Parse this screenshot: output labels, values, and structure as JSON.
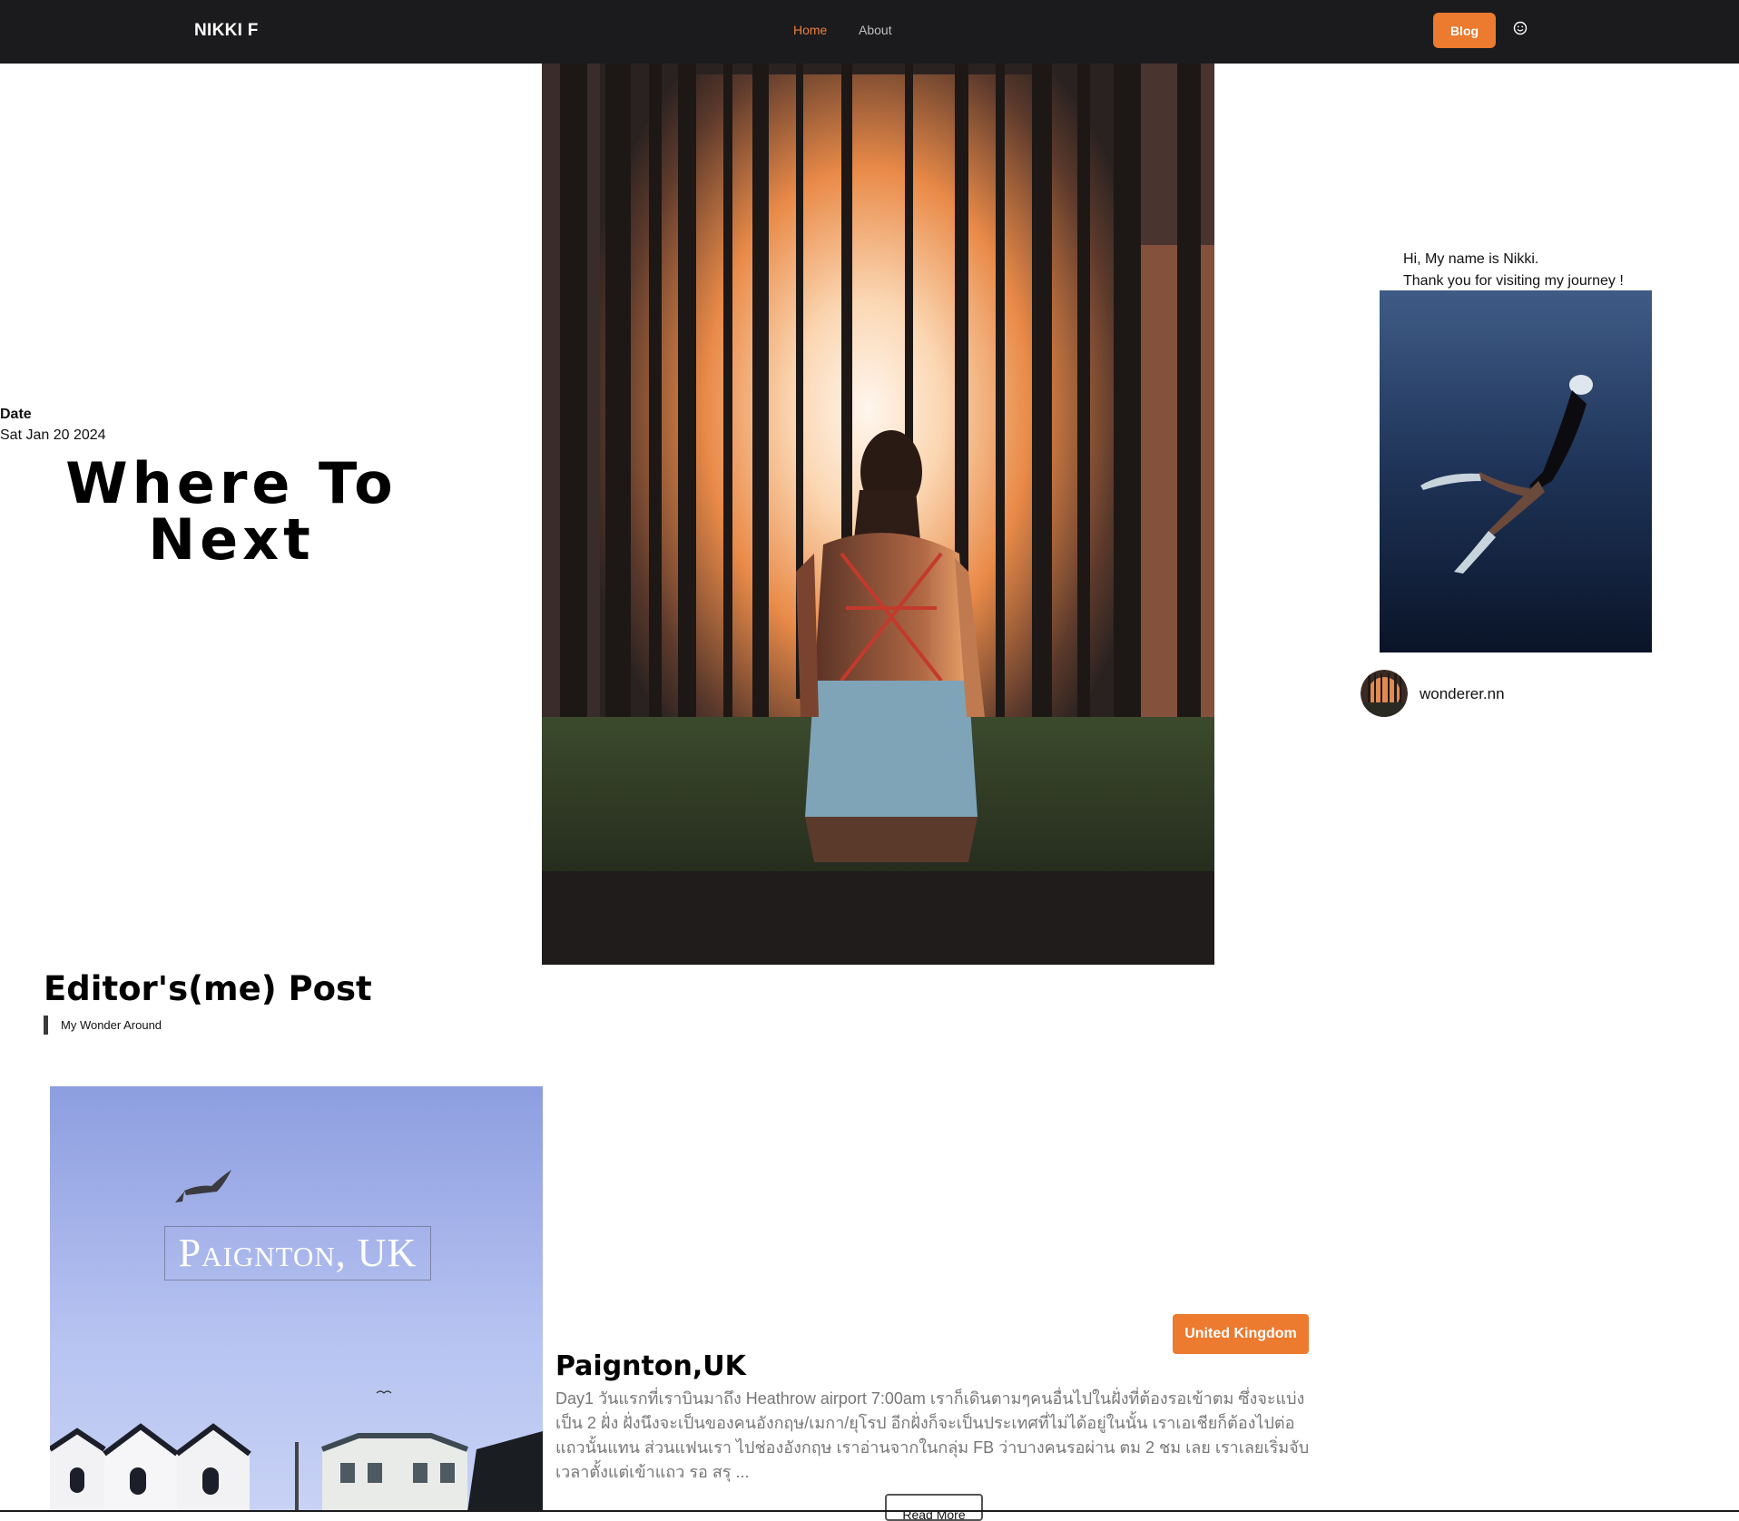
{
  "nav": {
    "brand": "NIKKI F",
    "links": [
      "Home",
      "About"
    ],
    "blog_label": "Blog",
    "account_icon": "smiley-face-icon"
  },
  "hero": {
    "date_label": "Date",
    "date_value": "Sat Jan 20 2024",
    "title_line1": "Where To",
    "title_line2": "Next",
    "image_alt": "woman in forest at sunset"
  },
  "profile": {
    "greeting_line1": "Hi, My name is Nikki.",
    "greeting_line2": "Thank you for visiting my journey !",
    "handle": "wonderer.nn"
  },
  "editor": {
    "title": "Editor's(me) Post",
    "subtitle": "My Wonder Around"
  },
  "post": {
    "image_caption": "Paignton, UK",
    "country": "United Kingdom",
    "title": "Paignton,UK",
    "excerpt": "Day1 วันแรกที่เราบินมาถึง Heathrow airport 7:00am เราก็เดินตามๆคนอื่นไปในฝั่งที่ต้องรอเข้าตม ซึ่งจะแบ่งเป็น 2 ฝั่ง ฝั่งนึงจะเป็นของคนอังกฤษ/เมกา/ยุโรป อีกฝั่งก็จะเป็นประเทศที่ไม่ได้อยู่ในนั้น เราเอเชียก็ต้องไปต่อแถวนั้นแทน ส่วนแฟนเรา ไปช่องอังกฤษ เราอ่านจากในกลุ่ม FB ว่าบางคนรอผ่าน ตม 2 ชม เลย เราเลยเริ่มจับเวลาตั้งแต่เข้าแถว รอ สรุ ...",
    "read_more": "Read More"
  },
  "colors": {
    "topbar": "#1b1b1d",
    "accent": "#ec7a2f",
    "nav_active": "#e8803a"
  }
}
